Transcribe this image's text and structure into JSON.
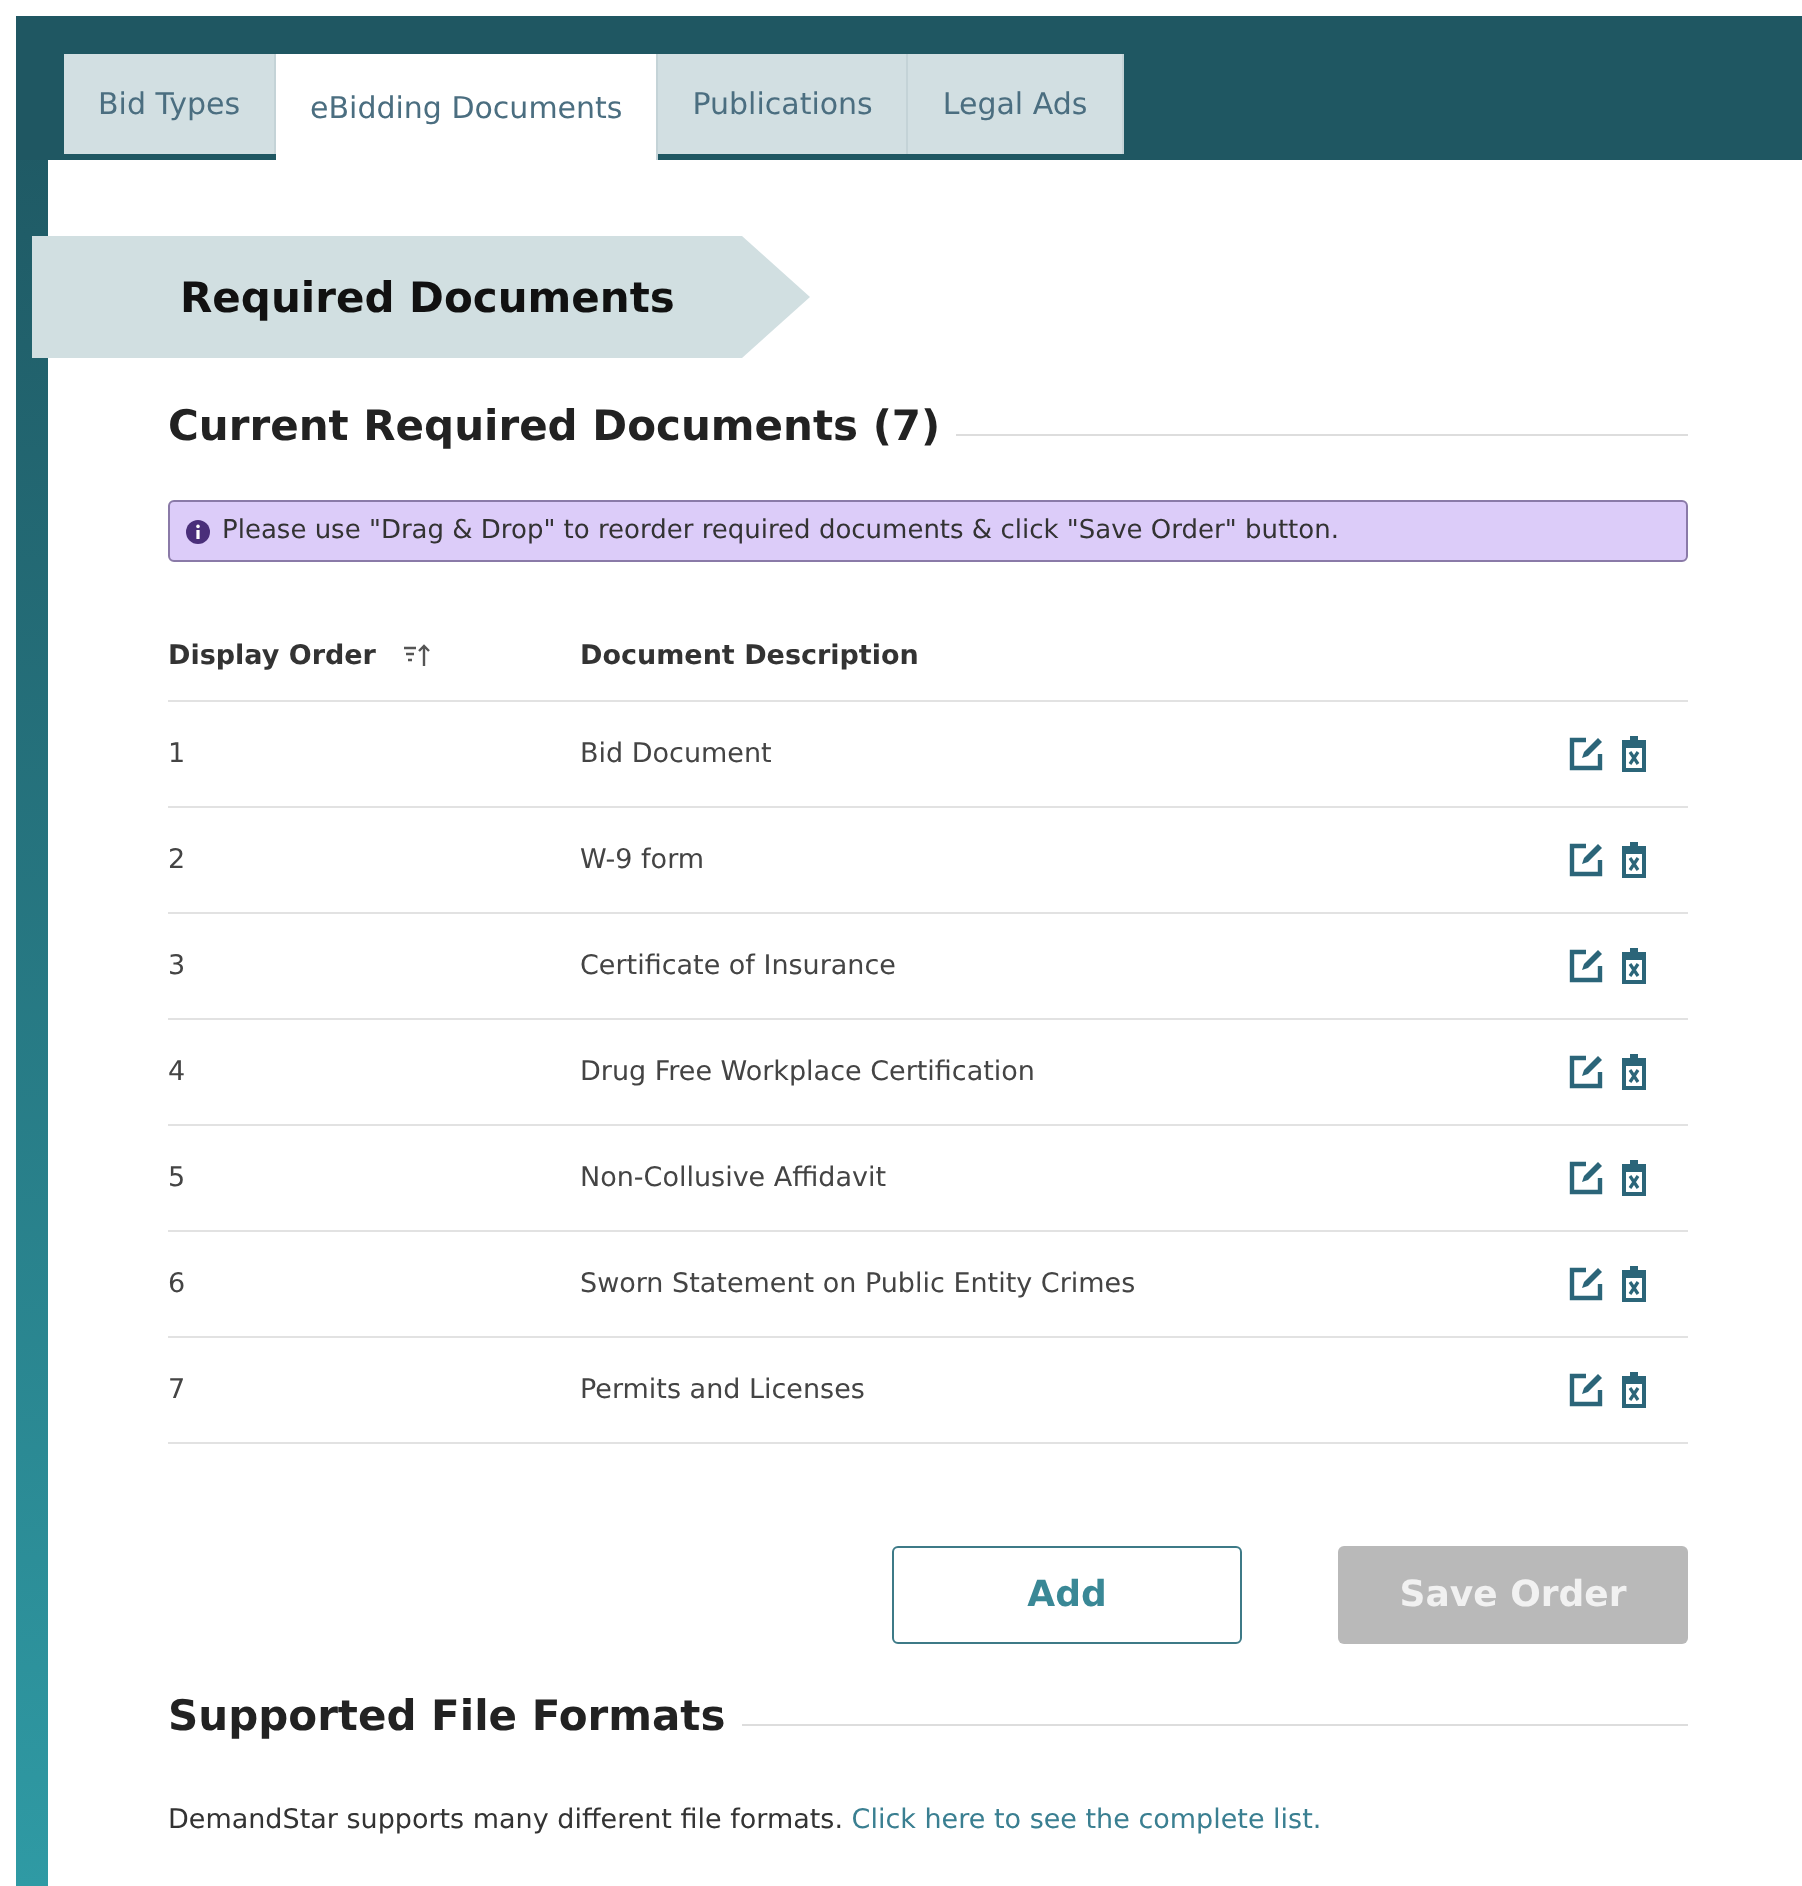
{
  "tabs": [
    {
      "label": "Bid Types",
      "selected": false
    },
    {
      "label": "eBidding Documents",
      "selected": true
    },
    {
      "label": "Publications",
      "selected": false
    },
    {
      "label": "Legal Ads",
      "selected": false
    }
  ],
  "banner": {
    "title": "Required Documents"
  },
  "current": {
    "heading": "Current Required Documents (7)",
    "notice": "Please use \"Drag & Drop\" to reorder required documents & click \"Save Order\" button.",
    "columns": [
      "Display Order",
      "Document Description"
    ],
    "rows": [
      {
        "order": "1",
        "description": "Bid Document"
      },
      {
        "order": "2",
        "description": "W-9 form"
      },
      {
        "order": "3",
        "description": "Certificate of Insurance"
      },
      {
        "order": "4",
        "description": "Drug Free Workplace Certification"
      },
      {
        "order": "5",
        "description": "Non-Collusive Affidavit"
      },
      {
        "order": "6",
        "description": "Sworn Statement on Public Entity Crimes"
      },
      {
        "order": "7",
        "description": "Permits and Licenses"
      }
    ],
    "buttons": [
      {
        "label": "Add",
        "kind": "outline",
        "disabled": false
      },
      {
        "label": "Save Order",
        "kind": "primary",
        "disabled": true
      }
    ]
  },
  "formats": {
    "heading": "Supported File Formats",
    "text": "DemandStar supports many different file formats.",
    "link": "Click here to see the complete list."
  }
}
